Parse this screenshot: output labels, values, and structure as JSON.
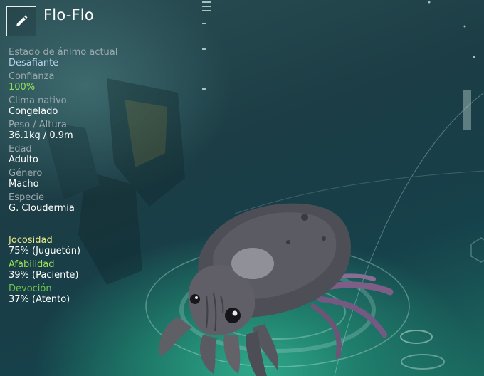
{
  "creature": {
    "name": "Flo-Flo"
  },
  "stats": [
    {
      "label": "Estado de ánimo actual",
      "value": "Desafiante"
    },
    {
      "label": "Confianza",
      "value": "100%"
    },
    {
      "label": "Clima nativo",
      "value": "Congelado"
    },
    {
      "label": "Peso / Altura",
      "value": "36.1kg / 0.9m"
    },
    {
      "label": "Edad",
      "value": "Adulto"
    },
    {
      "label": "Género",
      "value": "Macho"
    },
    {
      "label": "Especie",
      "value": "G. Cloudermia"
    }
  ],
  "traits": [
    {
      "label": "Jocosidad",
      "value": "75% (Juguetón)"
    },
    {
      "label": "Afabilidad",
      "value": "39% (Paciente)"
    },
    {
      "label": "Devoción",
      "value": "37% (Atento)"
    }
  ],
  "colors": {
    "mood": "#b8d4f0",
    "trust": "#8fe05a",
    "trait_jocosidad": "#e6e88a",
    "trait_afabilidad": "#9ae05a",
    "trait_devocion": "#6cc64c"
  },
  "icons": {
    "edit": "pencil-icon"
  }
}
